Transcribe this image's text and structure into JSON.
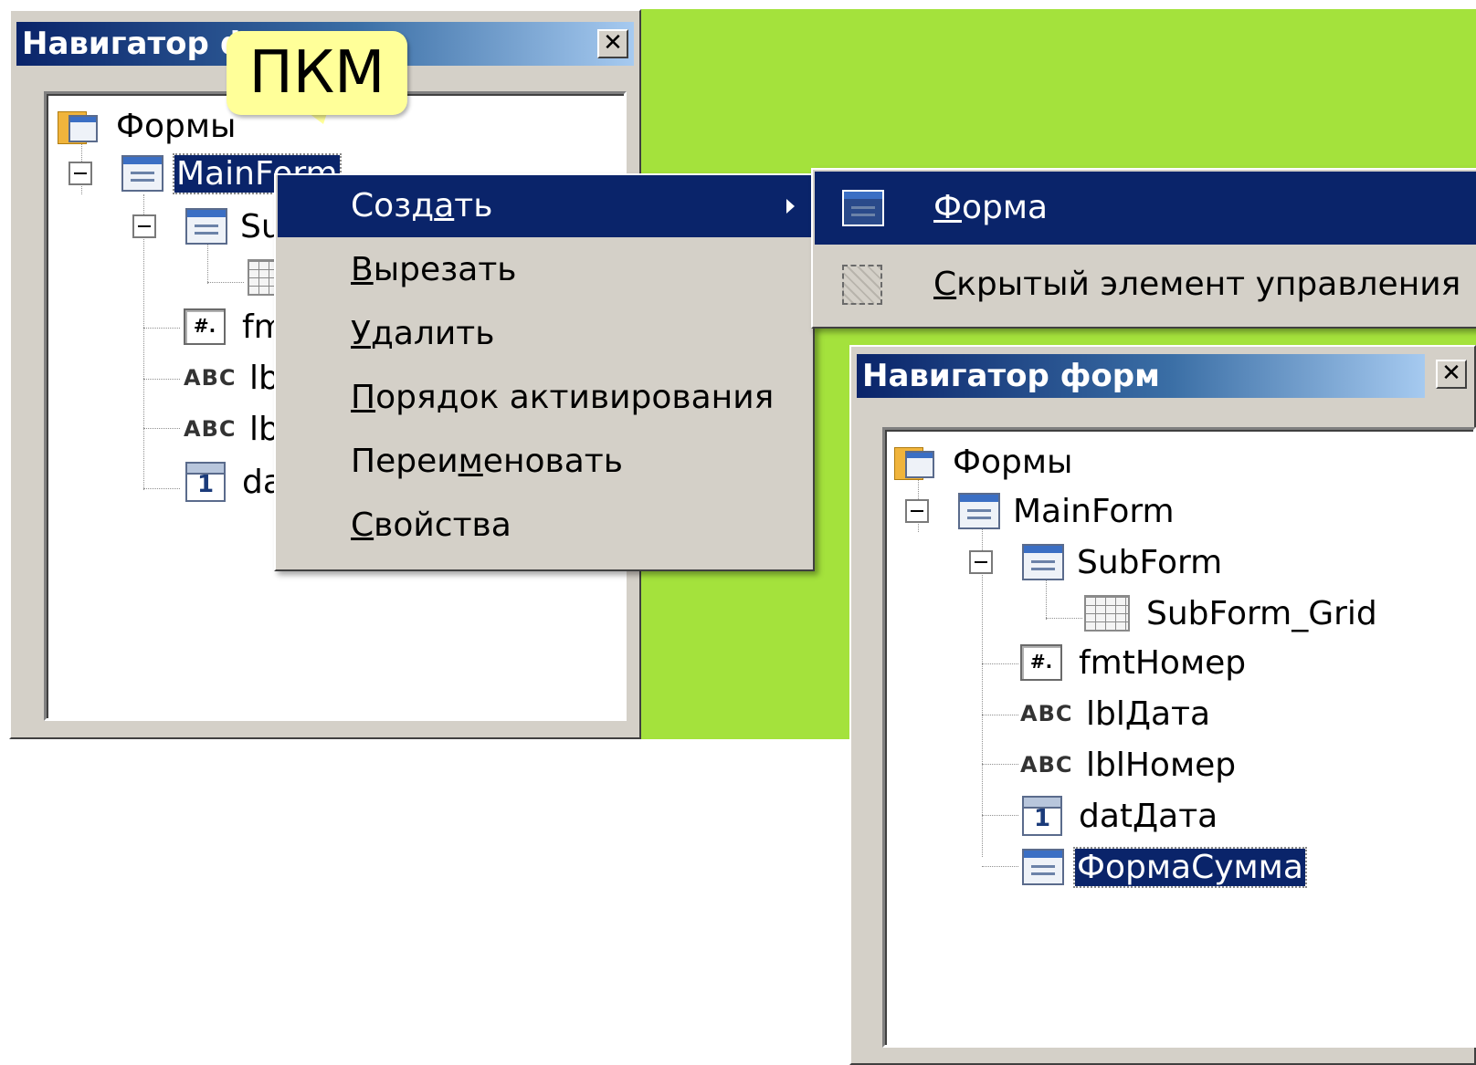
{
  "bubble": {
    "text": "ПКМ"
  },
  "left_window": {
    "title": "Навигатор форм",
    "close_glyph": "✕",
    "tree": {
      "root": "Формы",
      "main": "MainForm",
      "sub": "SubForm",
      "fmt": "fmtНомер",
      "lbl_date": "lblДата",
      "lbl_num": "lblНомер",
      "dat": "datДата"
    }
  },
  "context_menu": {
    "items": [
      {
        "pre": "Созд",
        "u": "а",
        "post": "ть"
      },
      {
        "pre": "",
        "u": "В",
        "post": "ырезать"
      },
      {
        "pre": "",
        "u": "У",
        "post": "далить"
      },
      {
        "pre": "",
        "u": "П",
        "post": "орядок активирования"
      },
      {
        "pre": "Переи",
        "u": "м",
        "post": "еновать"
      },
      {
        "pre": "",
        "u": "С",
        "post": "войства"
      }
    ]
  },
  "submenu": {
    "items": [
      {
        "pre": "",
        "u": "Ф",
        "post": "орма"
      },
      {
        "pre": "",
        "u": "С",
        "post": "крытый элемент управления"
      }
    ]
  },
  "right_window": {
    "title": "Навигатор форм",
    "close_glyph": "✕",
    "tree": {
      "root": "Формы",
      "main": "MainForm",
      "sub": "SubForm",
      "grid": "SubForm_Grid",
      "fmt": "fmtНомер",
      "lbl_date": "lblДата",
      "lbl_num": "lblНомер",
      "dat": "datДата",
      "new_form": "ФормаСумма"
    }
  },
  "icons": {
    "abc": "ABC",
    "fmt": "#.",
    "cal": "1"
  }
}
